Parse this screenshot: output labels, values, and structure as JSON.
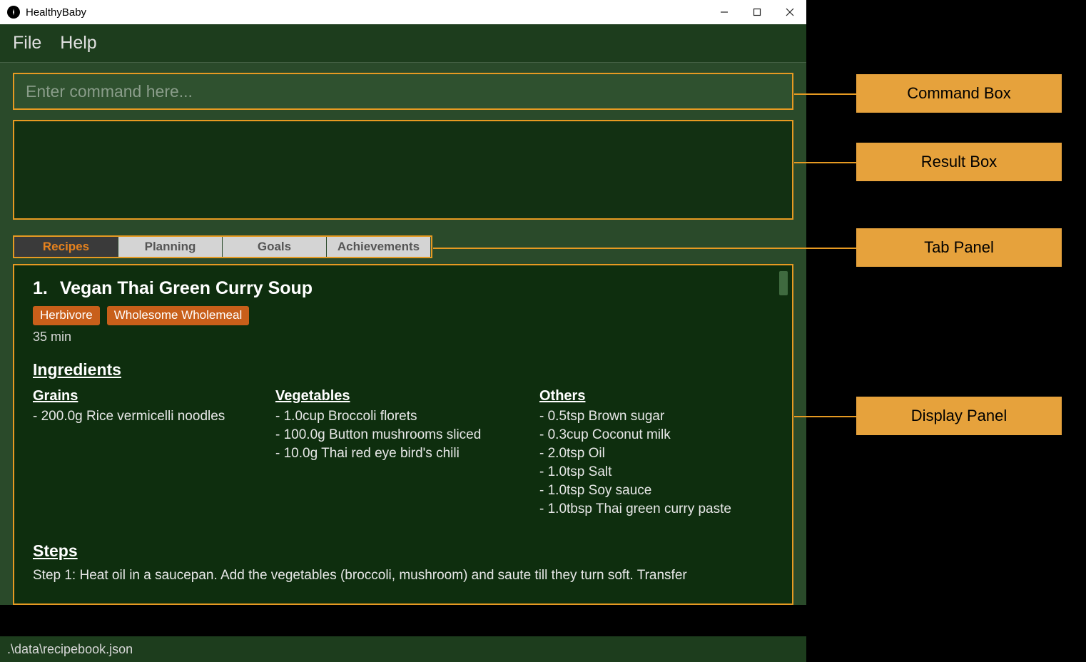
{
  "titlebar": {
    "app_name": "HealthyBaby"
  },
  "menubar": {
    "file": "File",
    "help": "Help"
  },
  "command": {
    "placeholder": "Enter command here..."
  },
  "tabs": {
    "recipes": "Recipes",
    "planning": "Planning",
    "goals": "Goals",
    "achievements": "Achievements"
  },
  "recipe": {
    "index": "1.",
    "title": "Vegan Thai Green Curry Soup",
    "tags": {
      "t0": "Herbivore",
      "t1": "Wholesome Wholemeal"
    },
    "time": "35 min",
    "ingredients_label": "Ingredients",
    "grains_label": "Grains",
    "grains": {
      "g0": "- 200.0g Rice vermicelli noodles"
    },
    "vegetables_label": "Vegetables",
    "vegetables": {
      "v0": "- 1.0cup Broccoli florets",
      "v1": "- 100.0g Button mushrooms sliced",
      "v2": "- 10.0g Thai red eye bird's chili"
    },
    "others_label": "Others",
    "others": {
      "o0": "- 0.5tsp Brown sugar",
      "o1": "- 0.3cup Coconut milk",
      "o2": "- 2.0tsp Oil",
      "o3": "- 1.0tsp Salt",
      "o4": "- 1.0tsp Soy sauce",
      "o5": "- 1.0tbsp Thai green curry paste"
    },
    "steps_label": "Steps",
    "step1": "Step 1: Heat oil in a saucepan. Add the vegetables (broccoli, mushroom) and saute till they turn soft. Transfer"
  },
  "statusbar": {
    "path": ".\\data\\recipebook.json"
  },
  "annotations": {
    "command_box": "Command Box",
    "result_box": "Result Box",
    "tab_panel": "Tab Panel",
    "display_panel": "Display Panel"
  }
}
